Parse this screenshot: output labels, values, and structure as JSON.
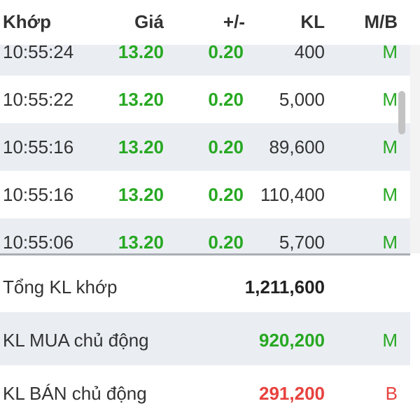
{
  "header": {
    "time": "Khớp",
    "price": "Giá",
    "change": "+/-",
    "volume": "KL",
    "side": "M/B"
  },
  "trades": [
    {
      "time": "10:55:24",
      "price": "13.20",
      "change": "0.20",
      "volume": "400",
      "side": "M"
    },
    {
      "time": "10:55:22",
      "price": "13.20",
      "change": "0.20",
      "volume": "5,000",
      "side": "M"
    },
    {
      "time": "10:55:16",
      "price": "13.20",
      "change": "0.20",
      "volume": "89,600",
      "side": "M"
    },
    {
      "time": "10:55:16",
      "price": "13.20",
      "change": "0.20",
      "volume": "110,400",
      "side": "M"
    },
    {
      "time": "10:55:06",
      "price": "13.20",
      "change": "0.20",
      "volume": "5,700",
      "side": "M"
    }
  ],
  "summary": {
    "total": {
      "label": "Tổng KL khớp",
      "value": "1,211,600",
      "side": ""
    },
    "buy": {
      "label": "KL MUA chủ động",
      "value": "920,200",
      "side": "M"
    },
    "sell": {
      "label": "KL BÁN chủ động",
      "value": "291,200",
      "side": "B"
    }
  },
  "colors": {
    "up": "#27a822",
    "down": "#e8423f",
    "row_alt": "#eaeef3",
    "text": "#333333"
  }
}
